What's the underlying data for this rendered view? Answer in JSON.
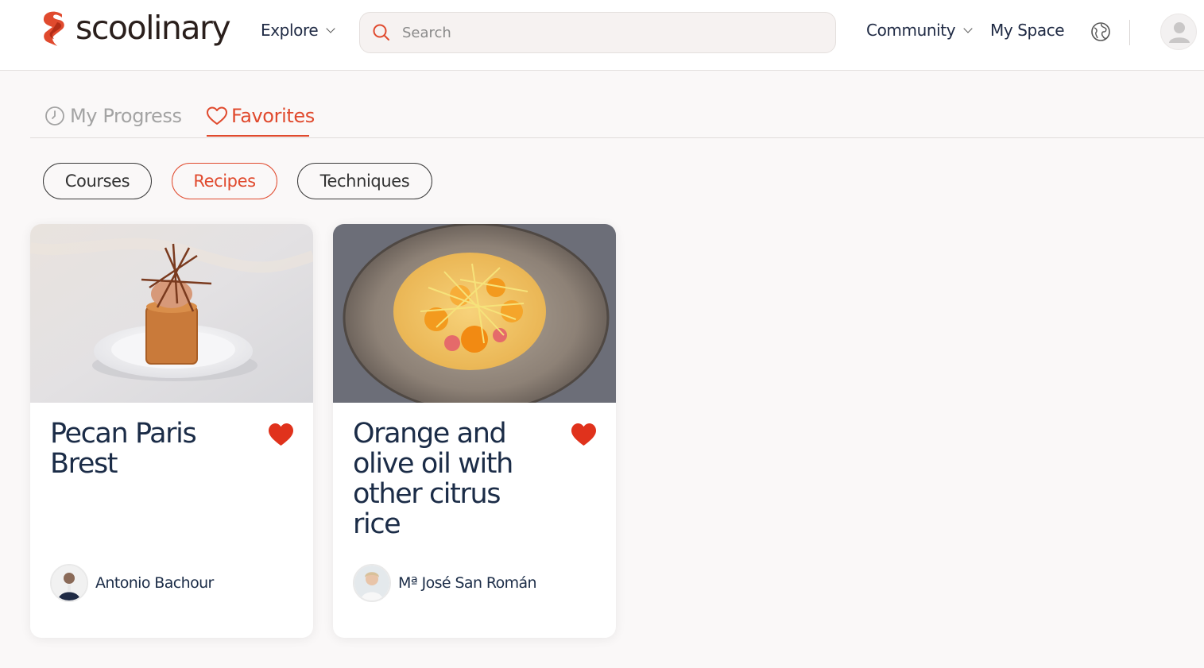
{
  "brand": {
    "name": "scoolinary",
    "accent": "#e04a2e",
    "dark": "#1b2c47"
  },
  "header": {
    "explore_label": "Explore",
    "search_placeholder": "Search",
    "community_label": "Community",
    "myspace_label": "My Space",
    "icons": [
      "search-icon",
      "chevron-down-icon",
      "globe-icon",
      "user-avatar-icon"
    ]
  },
  "tabs": [
    {
      "label": "My Progress",
      "icon": "clock-icon",
      "active": false
    },
    {
      "label": "Favorites",
      "icon": "heart-outline-icon",
      "active": true
    }
  ],
  "filters": [
    {
      "label": "Courses",
      "active": false
    },
    {
      "label": "Recipes",
      "active": true
    },
    {
      "label": "Techniques",
      "active": false
    }
  ],
  "cards": [
    {
      "title": "Pecan Paris Brest",
      "author": "Antonio Bachour",
      "favorited": true
    },
    {
      "title": "Orange and olive oil with other citrus rice",
      "author": "Mª José San Román",
      "favorited": true
    }
  ]
}
